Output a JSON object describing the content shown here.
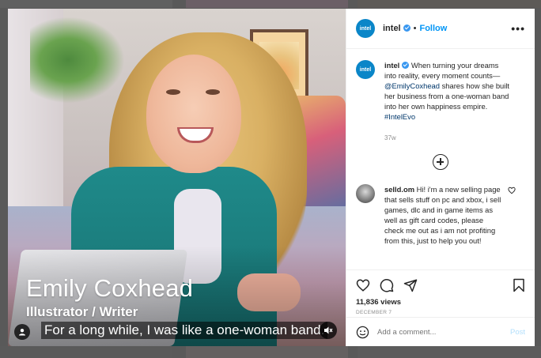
{
  "post": {
    "caption_overlay": {
      "name": "Emily Coxhead",
      "role": "Illustrator / Writer",
      "subtitle": "For a long while, I was like a one-woman band."
    }
  },
  "header": {
    "avatar_text": "intel",
    "username": "intel",
    "separator": "•",
    "follow_label": "Follow",
    "more_label": "•••"
  },
  "caption": {
    "avatar_text": "intel",
    "username": "intel",
    "text": "When turning your dreams into reality, every moment counts—",
    "mention": "@EmilyCoxhead",
    "text2": " shares how she built her business from a one-woman band into her own happiness empire. ",
    "hashtag": "#IntelEvo",
    "time": "37w"
  },
  "comment": {
    "username": "selld.om",
    "text": "Hi! i'm a new selling page that sells stuff on pc and xbox, i sell games, dlc and in game items as well as gift card codes, please check me out as i am not profiting from this, just to help you out!"
  },
  "stats": {
    "views": "11,836 views",
    "date": "DECEMBER 7"
  },
  "composer": {
    "placeholder": "Add a comment...",
    "post_label": "Post"
  },
  "icons": {
    "like": "heart-icon",
    "comment": "comment-icon",
    "share": "share-icon",
    "save": "bookmark-icon",
    "emoji": "emoji-icon",
    "load_more": "plus-circle-icon",
    "mute": "muted-speaker-icon",
    "tag": "user-icon"
  },
  "colors": {
    "brand_intel": "#0a86c8",
    "link_blue": "#0095f6",
    "post_disabled": "#b2dffc"
  }
}
